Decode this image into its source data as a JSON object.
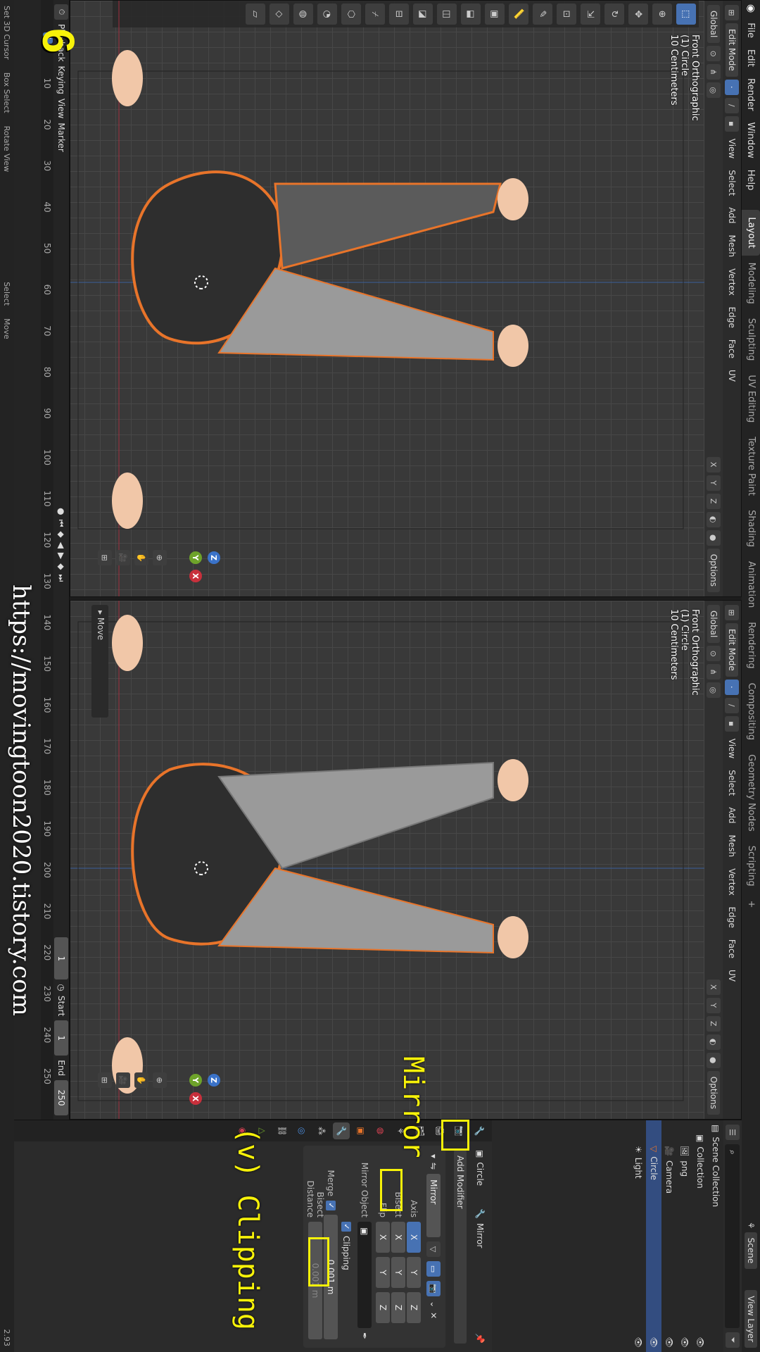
{
  "menu": [
    "File",
    "Edit",
    "Render",
    "Window",
    "Help"
  ],
  "workspaces": [
    "Layout",
    "Modeling",
    "Sculpting",
    "UV Editing",
    "Texture Paint",
    "Shading",
    "Animation",
    "Rendering",
    "Compositing",
    "Geometry Nodes",
    "Scripting",
    "+"
  ],
  "top_right": {
    "scene": "Scene",
    "view_layer": "View Layer"
  },
  "viewport": {
    "mode": "Edit Mode",
    "menus": [
      "View",
      "Select",
      "Add",
      "Mesh",
      "Vertex",
      "Edge",
      "Face",
      "UV"
    ],
    "orientation": "Global",
    "options": "Options",
    "axes": [
      "X",
      "Y",
      "Z"
    ],
    "info": [
      "Front Orthographic",
      "(1) Circle",
      "10 Centimeters"
    ]
  },
  "operator_panel": "Move",
  "outliner": {
    "items": [
      "Scene Collection",
      "Collection",
      "png",
      "Camera",
      "Circle",
      "Light"
    ]
  },
  "props": {
    "object": "Circle",
    "modifier_name_label": "Mirror",
    "add_modifier": "Add Modifier",
    "modifier_field": "Mirror",
    "axis_label": "Axis",
    "bisect_label": "Bisect",
    "flip_label": "Flip",
    "xyz": [
      "X",
      "Y",
      "Z"
    ],
    "mirror_object": "Mirror Object",
    "clipping": "Clipping",
    "merge": "Merge",
    "merge_value": "0.001 m",
    "bisect_distance": "Bisect Distance",
    "bisect_distance_value": "0.001 m"
  },
  "timeline": {
    "menus": [
      "Playback",
      "Keying",
      "View",
      "Marker"
    ],
    "ticks": [
      "0",
      "10",
      "20",
      "30",
      "40",
      "50",
      "60",
      "70",
      "80",
      "90",
      "100",
      "110",
      "120",
      "130",
      "140",
      "150",
      "160",
      "170",
      "180",
      "190",
      "200",
      "210",
      "220",
      "230",
      "240",
      "250"
    ],
    "current_frame": "1",
    "frame": "1",
    "start_label": "Start",
    "start": "1",
    "end_label": "End",
    "end": "250"
  },
  "status": [
    "Set 3D Cursor",
    "Box Select",
    "Rotate View",
    "Select",
    "Move"
  ],
  "version": "2.93",
  "annotations": {
    "step": "6",
    "mirror": "Mirror",
    "clipping": "(v) Clipping",
    "url": "https://movingtoon2020.tistory.com"
  },
  "colors": {
    "accent": "#4772b3",
    "highlight": "#f7f209",
    "x_axis": "#c8303c",
    "y_axis": "#6ea32a",
    "z_axis": "#3a72c8",
    "edge": "#e8742a"
  }
}
